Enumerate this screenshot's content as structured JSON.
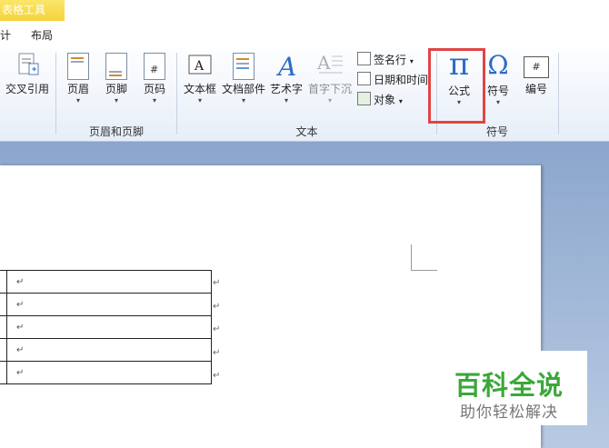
{
  "context_tab": {
    "title": "表格工具"
  },
  "tabs": [
    {
      "label": "计"
    },
    {
      "label": "布局"
    }
  ],
  "ribbon": {
    "cross_ref": {
      "label": "交叉引用"
    },
    "header_footer_group": {
      "label": "页眉和页脚",
      "buttons": [
        {
          "label": "页眉",
          "arrow": "▾"
        },
        {
          "label": "页脚",
          "arrow": "▾"
        },
        {
          "label": "页码",
          "arrow": "▾"
        }
      ]
    },
    "text_group": {
      "label": "文本",
      "buttons": [
        {
          "label": "文本框",
          "arrow": "▾"
        },
        {
          "label": "文档部件",
          "arrow": "▾"
        },
        {
          "label": "艺术字",
          "arrow": "▾"
        },
        {
          "label": "首字下沉",
          "arrow": "▾"
        }
      ],
      "small_buttons": [
        {
          "label": "签名行",
          "arrow": "▾"
        },
        {
          "label": "日期和时间",
          "arrow": ""
        },
        {
          "label": "对象",
          "arrow": "▾"
        }
      ]
    },
    "symbols_group": {
      "label": "符号",
      "buttons": [
        {
          "label": "公式",
          "arrow": "▾",
          "glyph": "π"
        },
        {
          "label": "符号",
          "arrow": "▾",
          "glyph": "Ω"
        },
        {
          "label": "编号",
          "arrow": "",
          "glyph": "#"
        }
      ]
    }
  },
  "document": {
    "cell_mark": "↵",
    "row_count": 5
  },
  "watermark": {
    "title": "百科全说",
    "subtitle": "助你轻松解决"
  },
  "colors": {
    "highlight": "#e04545",
    "accent": "#1f5fbf",
    "watermark_green": "#3aa838"
  }
}
